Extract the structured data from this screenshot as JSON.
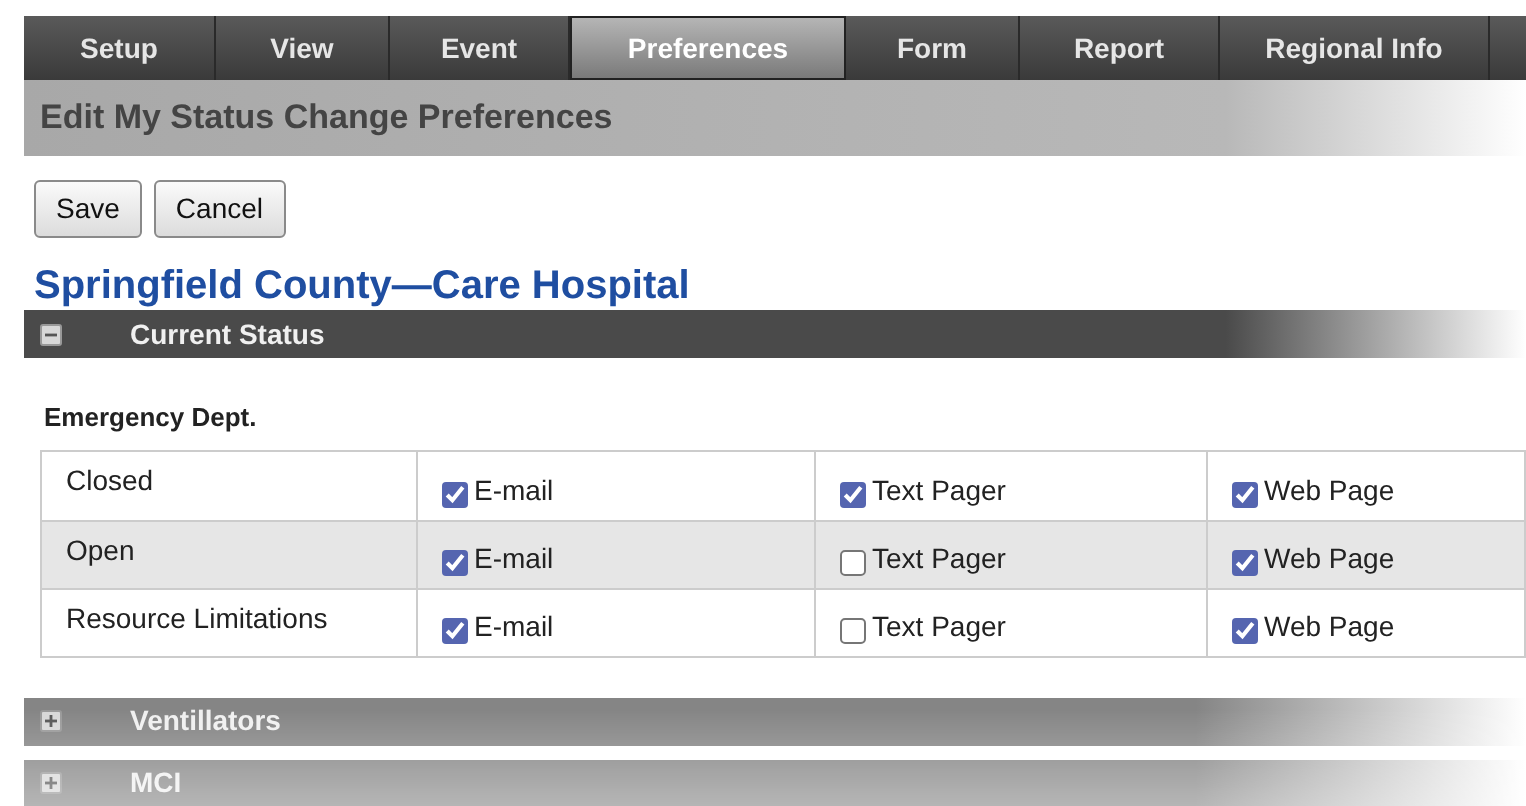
{
  "tabs": [
    {
      "label": "Setup",
      "selected": false
    },
    {
      "label": "View",
      "selected": false
    },
    {
      "label": "Event",
      "selected": false
    },
    {
      "label": "Preferences",
      "selected": true
    },
    {
      "label": "Form",
      "selected": false
    },
    {
      "label": "Report",
      "selected": false
    },
    {
      "label": "Regional Info",
      "selected": false
    }
  ],
  "page_title": "Edit My Status Change Preferences",
  "buttons": [
    "Save",
    "Cancel"
  ],
  "facility": "Springfield County—Care Hospital",
  "sections": [
    {
      "title": "Current Status",
      "expanded": true,
      "group": "Emergency Dept.",
      "rows": [
        {
          "status": "Closed",
          "options": [
            {
              "label": "E-mail",
              "checked": true
            },
            {
              "label": "Text Pager",
              "checked": true
            },
            {
              "label": "Web Page",
              "checked": true
            }
          ]
        },
        {
          "status": "Open",
          "options": [
            {
              "label": "E-mail",
              "checked": true
            },
            {
              "label": "Text Pager",
              "checked": false
            },
            {
              "label": "Web Page",
              "checked": true
            }
          ]
        },
        {
          "status": "Resource Limitations",
          "options": [
            {
              "label": "E-mail",
              "checked": true
            },
            {
              "label": "Text Pager",
              "checked": false
            },
            {
              "label": "Web Page",
              "checked": true
            }
          ]
        }
      ]
    },
    {
      "title": "Ventillators",
      "expanded": false
    },
    {
      "title": "MCI",
      "expanded": false
    }
  ]
}
